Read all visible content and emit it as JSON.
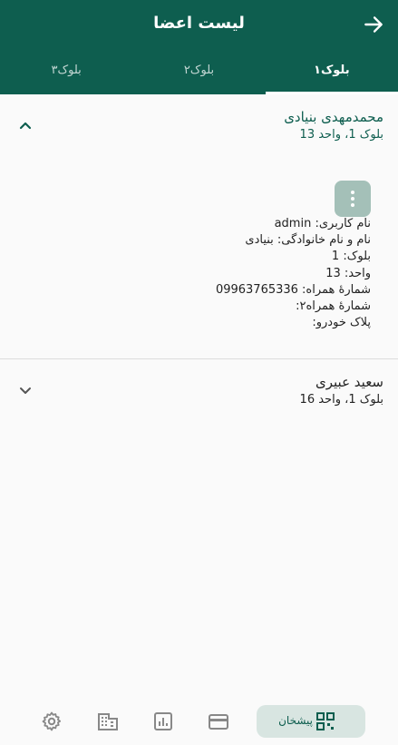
{
  "header": {
    "title": "لیست اعضا",
    "back_icon": "arrow-right-icon"
  },
  "tabs": [
    {
      "label": "بلوک۱",
      "active": true
    },
    {
      "label": "بلوک۲",
      "active": false
    },
    {
      "label": "بلوک۳",
      "active": false
    }
  ],
  "members": [
    {
      "name": "محمدمهدی بنیادی",
      "subtitle": "بلوک 1، واحد 13",
      "expanded": true,
      "details": [
        "نام کاربری: admin",
        "نام و نام خانوادگی: بنیادی",
        "بلوک: 1",
        "واحد: 13",
        "شمارهٔ همراه: 09963765336",
        "شمارهٔ همراه۲:",
        "پلاک خودرو:"
      ]
    },
    {
      "name": "سعید عبیری",
      "subtitle": "بلوک 1، واحد 16",
      "expanded": false
    }
  ],
  "bottom_nav": {
    "active_label": "پیشخان",
    "items": [
      "dashboard-icon",
      "card-icon",
      "chart-icon",
      "building-icon",
      "settings-icon"
    ]
  },
  "colors": {
    "primary": "#0e5e4f",
    "accent_light": "#d8e5e1",
    "menu_button": "#a4c0b8"
  }
}
